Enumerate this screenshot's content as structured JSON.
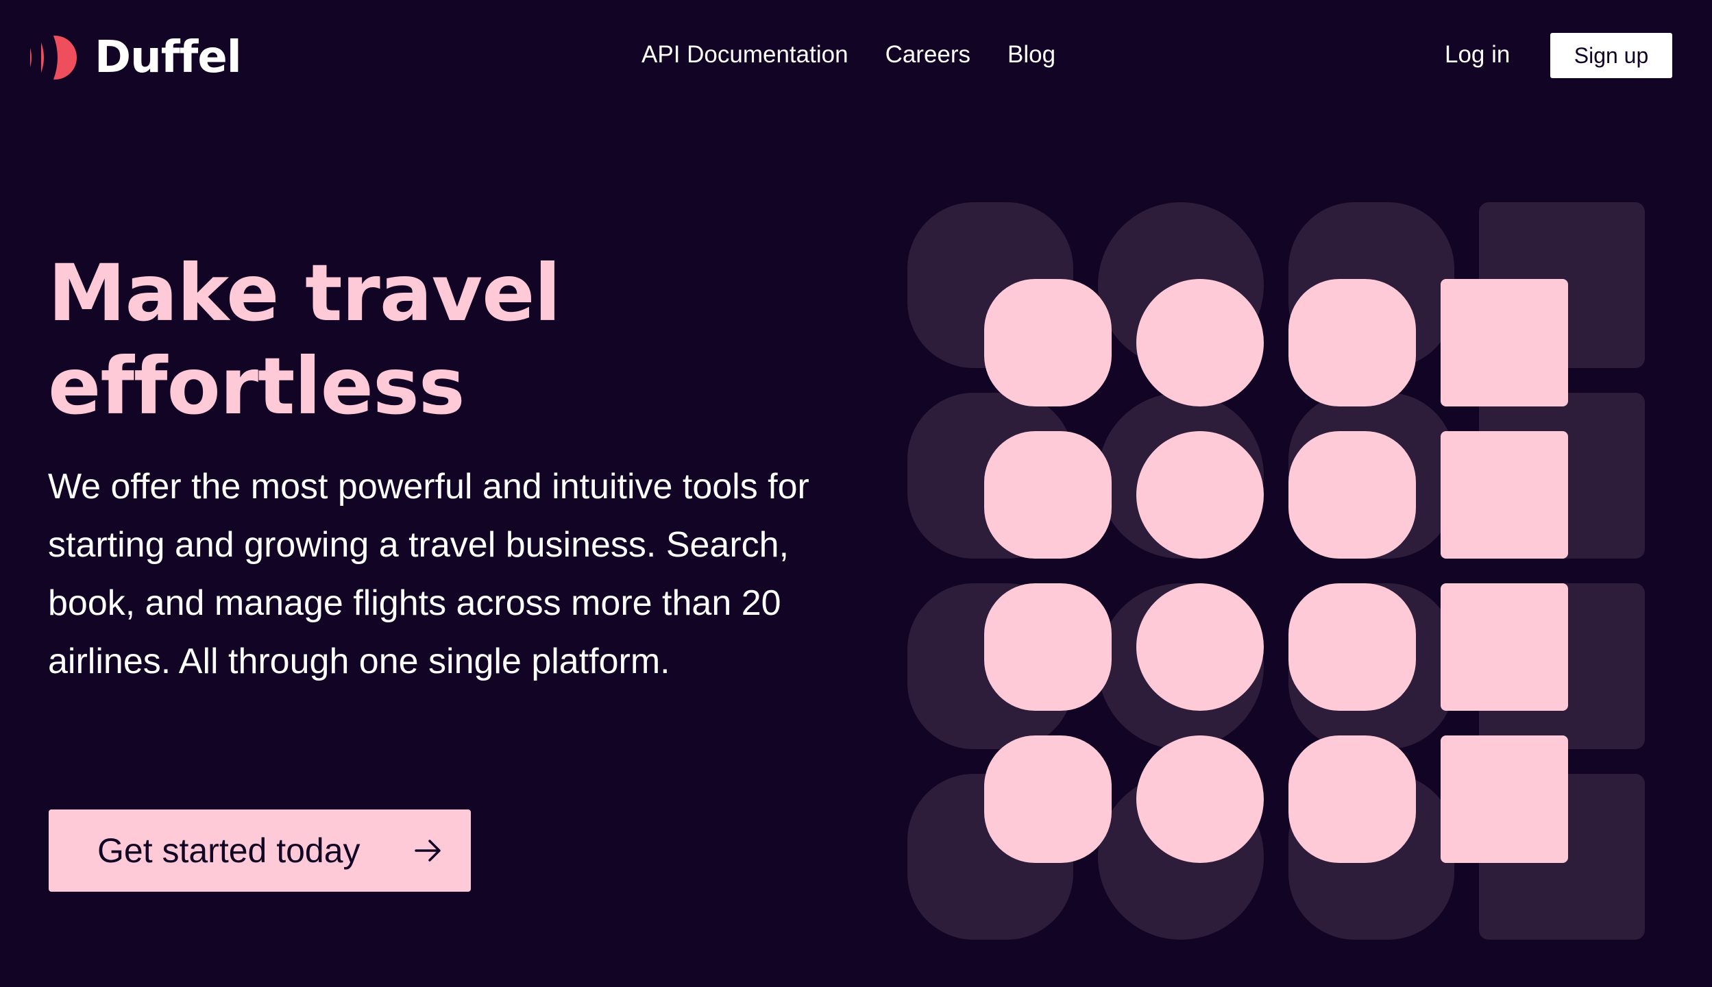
{
  "brand": {
    "name": "Duffel",
    "logo_color": "#ef4f5d",
    "background": "#120425",
    "accent": "#ffcad7",
    "shadow_shape": "#2d1d3b"
  },
  "nav": {
    "items": [
      {
        "label": "API Documentation"
      },
      {
        "label": "Careers"
      },
      {
        "label": "Blog"
      }
    ],
    "login_label": "Log in",
    "signup_label": "Sign up"
  },
  "hero": {
    "title_line1": "Make travel",
    "title_line2": "effortless",
    "description": "We offer the most powerful and intuitive tools for starting and growing a travel business. Search, book, and manage flights across more than 20 airlines. All through one single platform.",
    "cta_label": "Get started today",
    "cta_icon": "arrow-right-icon"
  },
  "graphic": {
    "columns": [
      "rounded-square",
      "circle",
      "rounded-square",
      "square"
    ],
    "rows": 4
  }
}
